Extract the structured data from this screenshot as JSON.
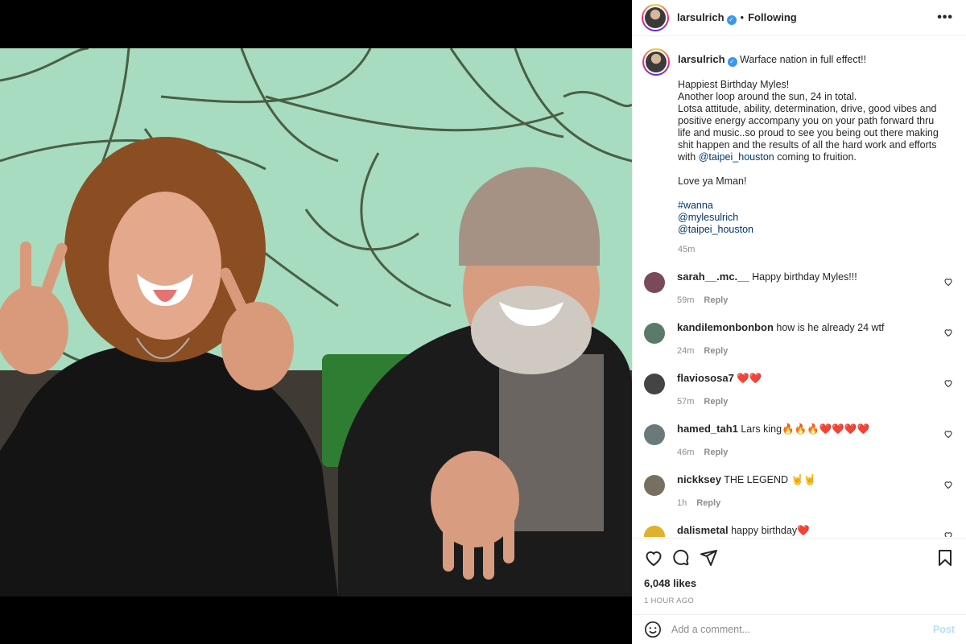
{
  "header": {
    "username": "larsulrich",
    "follow_status": "Following",
    "more_label": "•••"
  },
  "caption": {
    "username": "larsulrich",
    "first_line": "Warface nation in full effect!!",
    "lines": [
      "Happiest Birthday Myles!",
      "Another loop around the sun, 24 in total.",
      "Lotsa attitude, ability, determination, drive, good vibes and positive energy accompany you on your path forward thru life and music..so proud to see you being out there making shit happen and the results of all the hard work and efforts with"
    ],
    "mention_inline": "@taipei_houston",
    "line_after_mention": " coming to fruition.",
    "love_line": "Love ya Mman!",
    "hashtag": "#wanna",
    "mention_1": "@mylesulrich",
    "mention_2": "@taipei_houston",
    "time": "45m"
  },
  "comments": [
    {
      "username": "sarah__.mc.__",
      "text": "Happy birthday Myles!!!",
      "time": "59m",
      "reply": "Reply",
      "avatar_color": "#7a4a5a"
    },
    {
      "username": "kandilemonbonbon",
      "text": "how is he already 24 wtf",
      "time": "24m",
      "reply": "Reply",
      "avatar_color": "#5a7a6a"
    },
    {
      "username": "flaviososa7",
      "text": "❤️❤️",
      "time": "57m",
      "reply": "Reply",
      "avatar_color": "#444444"
    },
    {
      "username": "hamed_tah1",
      "text": "Lars king🔥🔥🔥❤️❤️❤️❤️",
      "time": "46m",
      "reply": "Reply",
      "avatar_color": "#6a7a7a"
    },
    {
      "username": "nickksey",
      "text": "THE LEGEND 🤘🤘",
      "time": "1h",
      "reply": "Reply",
      "avatar_color": "#777060"
    },
    {
      "username": "dalismetal",
      "text": "happy birthday❤️",
      "time": "",
      "reply": "",
      "avatar_color": "#e0b030"
    }
  ],
  "actions": {
    "likes": "6,048 likes",
    "posted_ago": "1 HOUR AGO"
  },
  "add_comment": {
    "placeholder": "Add a comment...",
    "post_label": "Post"
  }
}
